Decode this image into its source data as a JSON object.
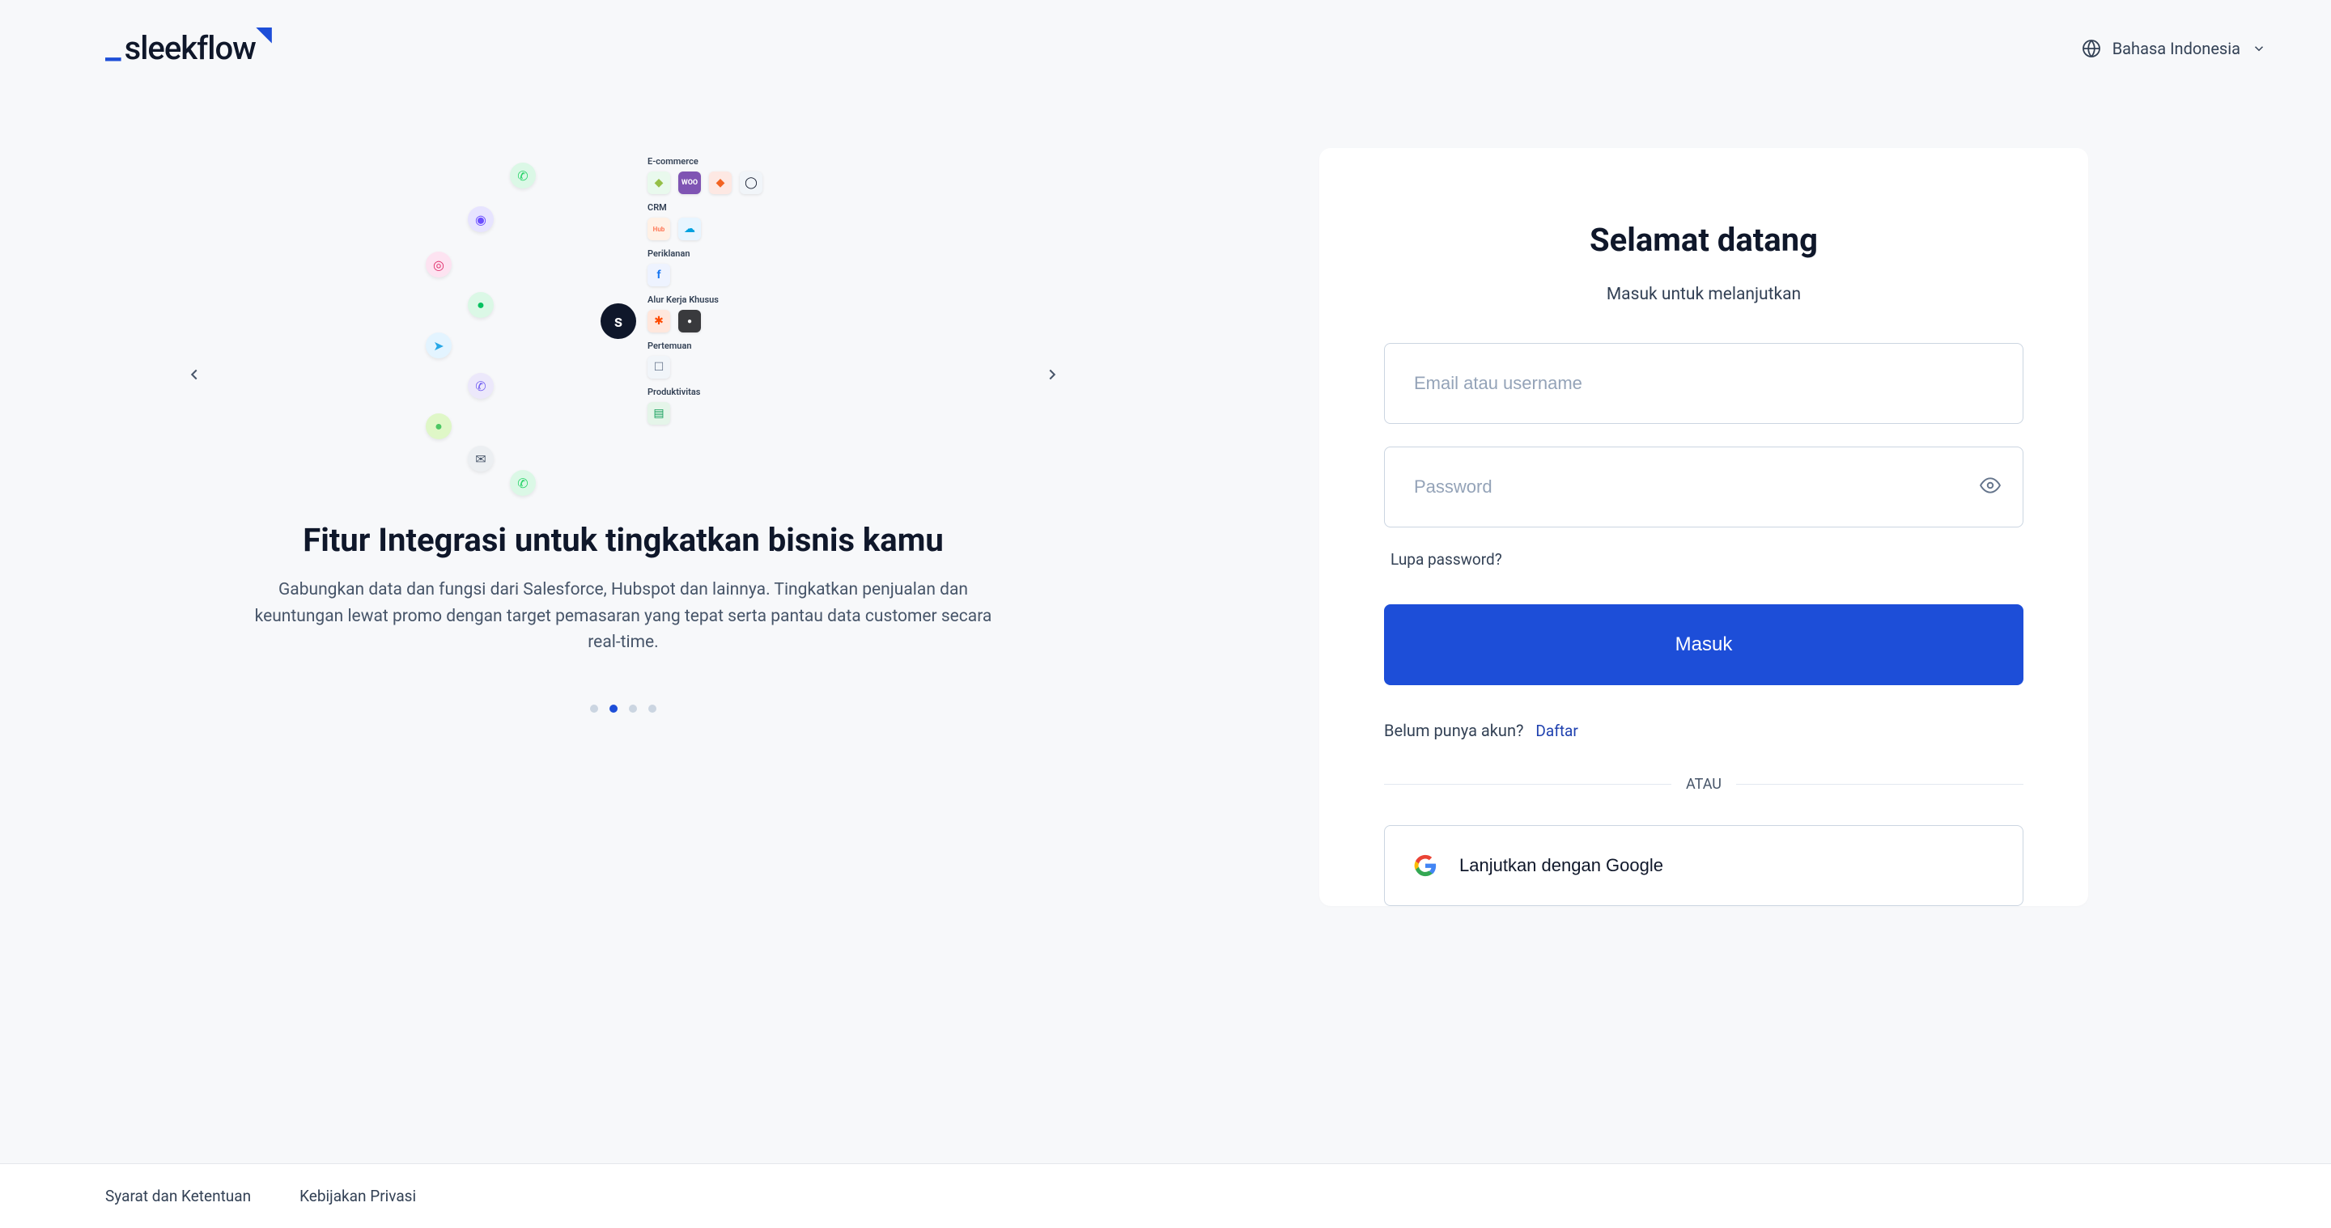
{
  "header": {
    "logo_text": "sleekflow",
    "language": "Bahasa Indonesia"
  },
  "carousel": {
    "illustration": {
      "sections": {
        "ecommerce": "E-commerce",
        "crm": "CRM",
        "ads": "Periklanan",
        "workflow": "Alur Kerja Khusus",
        "meeting": "Pertemuan",
        "productivity": "Produktivitas"
      }
    },
    "title": "Fitur Integrasi untuk tingkatkan bisnis kamu",
    "description": "Gabungkan data dan fungsi dari Salesforce, Hubspot dan lainnya. Tingkatkan penjualan dan keuntungan lewat promo dengan target pemasaran yang tepat serta pantau data customer secara real-time.",
    "active_dot": 1,
    "num_dots": 4
  },
  "form": {
    "title": "Selamat datang",
    "subtitle": "Masuk untuk melanjutkan",
    "email_placeholder": "Email atau username",
    "password_placeholder": "Password",
    "forgot": "Lupa password?",
    "submit": "Masuk",
    "no_account_text": "Belum punya akun?",
    "signup_link": "Daftar",
    "divider": "ATAU",
    "google": "Lanjutkan dengan Google"
  },
  "footer": {
    "terms": "Syarat dan Ketentuan",
    "privacy": "Kebijakan Privasi"
  }
}
